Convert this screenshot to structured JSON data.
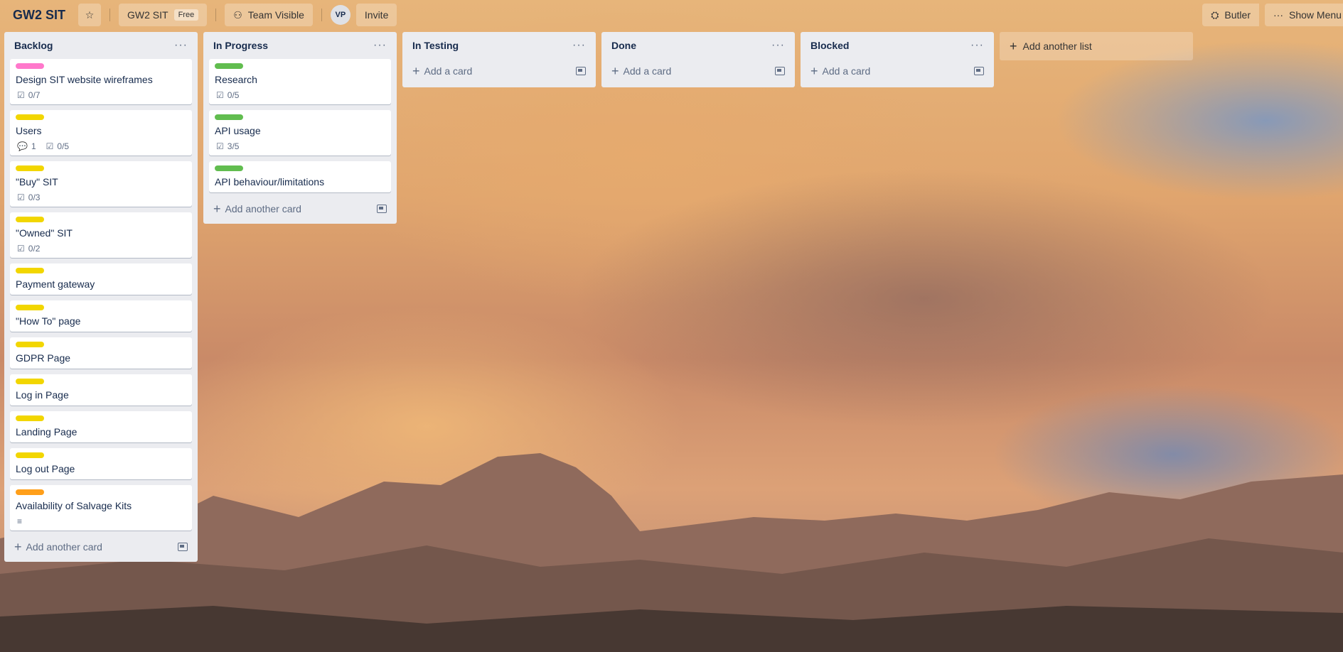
{
  "board": {
    "title": "GW2 SIT",
    "workspace": "GW2 SIT",
    "plan_badge": "Free",
    "visibility": "Team Visible",
    "avatar_initials": "VP",
    "invite_label": "Invite",
    "butler_label": "Butler",
    "show_menu_label": "Show Menu"
  },
  "colors": {
    "pink": "#ff78cb",
    "yellow": "#f2d600",
    "green": "#61bd4f",
    "orange": "#ff9f1a"
  },
  "lists": [
    {
      "title": "Backlog",
      "add_label": "Add another card",
      "cards": [
        {
          "title": "Design SIT website wireframes",
          "label": "pink",
          "checklist": "0/7"
        },
        {
          "title": "Users",
          "label": "yellow",
          "comments": "1",
          "checklist": "0/5"
        },
        {
          "title": "\"Buy\" SIT",
          "label": "yellow",
          "checklist": "0/3"
        },
        {
          "title": "\"Owned\" SIT",
          "label": "yellow",
          "checklist": "0/2"
        },
        {
          "title": "Payment gateway",
          "label": "yellow"
        },
        {
          "title": "\"How To\" page",
          "label": "yellow"
        },
        {
          "title": "GDPR Page",
          "label": "yellow"
        },
        {
          "title": "Log in Page",
          "label": "yellow"
        },
        {
          "title": "Landing Page",
          "label": "yellow"
        },
        {
          "title": "Log out Page",
          "label": "yellow"
        },
        {
          "title": "Availability of Salvage Kits",
          "label": "orange",
          "description": true
        }
      ]
    },
    {
      "title": "In Progress",
      "add_label": "Add another card",
      "cards": [
        {
          "title": "Research",
          "label": "green",
          "checklist": "0/5"
        },
        {
          "title": "API usage",
          "label": "green",
          "checklist": "3/5"
        },
        {
          "title": "API behaviour/limitations",
          "label": "green"
        }
      ]
    },
    {
      "title": "In Testing",
      "add_label": "Add a card",
      "cards": []
    },
    {
      "title": "Done",
      "add_label": "Add a card",
      "cards": []
    },
    {
      "title": "Blocked",
      "add_label": "Add a card",
      "cards": []
    }
  ],
  "add_list_label": "Add another list"
}
